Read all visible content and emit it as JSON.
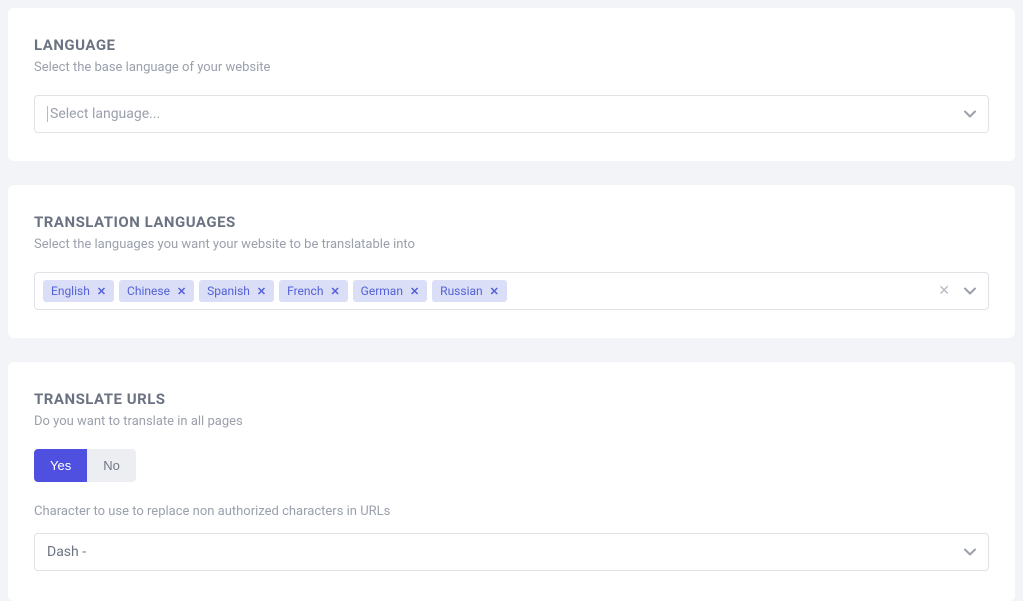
{
  "language_card": {
    "title": "LANGUAGE",
    "subtitle": "Select the base language of your website",
    "placeholder": "Select language..."
  },
  "translation_card": {
    "title": "TRANSLATION LANGUAGES",
    "subtitle": "Select the languages you want your website to be translatable into",
    "tags": [
      "English",
      "Chinese",
      "Spanish",
      "French",
      "German",
      "Russian"
    ]
  },
  "urls_card": {
    "title": "TRANSLATE URLS",
    "subtitle": "Do you want to translate in all pages",
    "option_yes": "Yes",
    "option_no": "No",
    "char_label": "Character to use to replace non authorized characters in URLs",
    "char_value": "Dash -"
  },
  "glyphs": {
    "x": "✕"
  }
}
